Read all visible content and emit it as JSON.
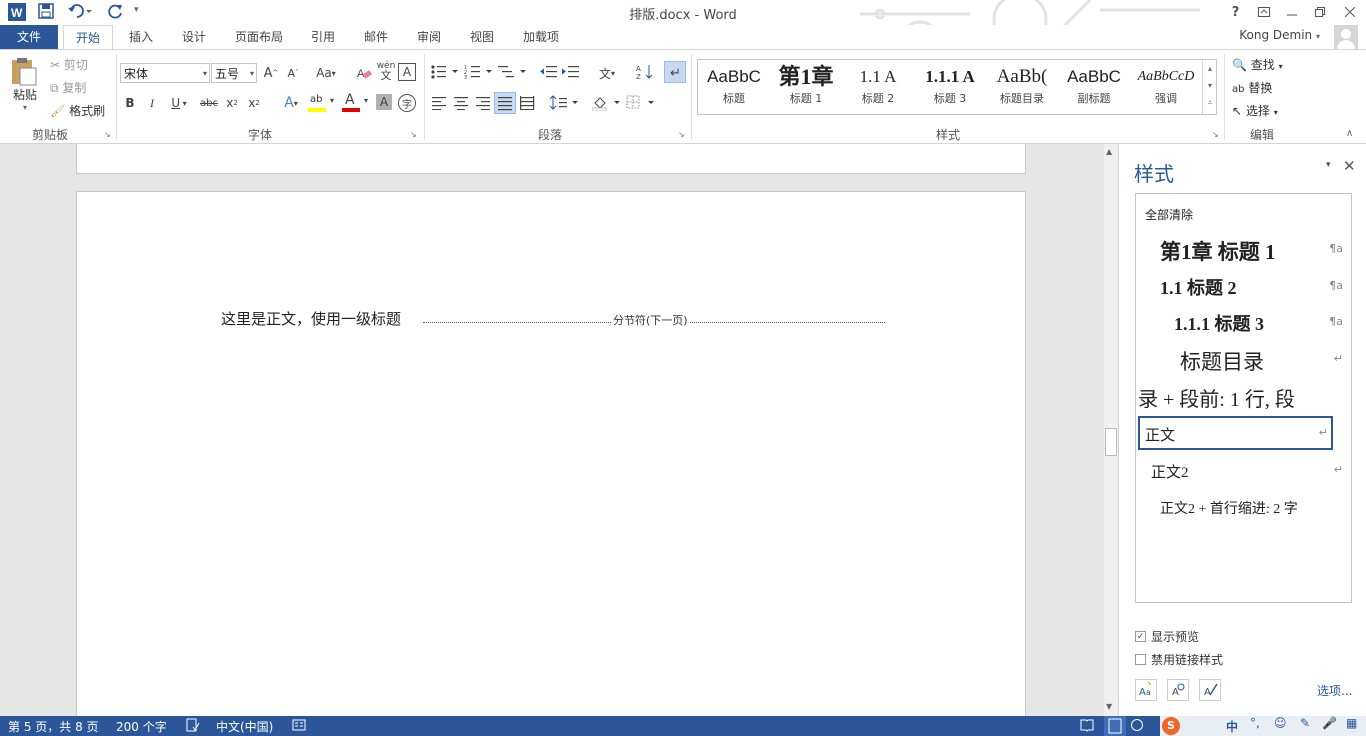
{
  "app": {
    "window_title": "排版.docx - Word",
    "help_label": "?",
    "user_name": "Kong Demin"
  },
  "tabs": [
    {
      "label": "文件"
    },
    {
      "label": "开始"
    },
    {
      "label": "插入"
    },
    {
      "label": "设计"
    },
    {
      "label": "页面布局"
    },
    {
      "label": "引用"
    },
    {
      "label": "邮件"
    },
    {
      "label": "审阅"
    },
    {
      "label": "视图"
    },
    {
      "label": "加载项"
    }
  ],
  "ribbon": {
    "clipboard": {
      "paste_label": "粘贴",
      "cut_label": "剪切",
      "copy_label": "复制",
      "format_painter_label": "格式刷",
      "group_label": "剪贴板"
    },
    "font": {
      "font_name": "宋体",
      "font_size": "五号",
      "grow_label": "A",
      "shrink_label": "A",
      "case_label": "Aa",
      "phonetic_label": "wén",
      "border_char_label": "A",
      "bold_label": "B",
      "italic_label": "I",
      "underline_label": "U",
      "strike_label": "abc",
      "subscript_label": "x",
      "superscript_label": "x",
      "effects_label": "A",
      "highlight_label": "ab",
      "color_label": "A",
      "shading_label": "A",
      "enclose_label": "字",
      "group_label": "字体"
    },
    "paragraph": {
      "group_label": "段落"
    },
    "styles": {
      "items": [
        {
          "preview": "AaBbC",
          "name": "标题"
        },
        {
          "preview": "第1章",
          "name": "标题 1"
        },
        {
          "preview": "1.1 A",
          "name": "标题 2"
        },
        {
          "preview": "1.1.1 A",
          "name": "标题 3"
        },
        {
          "preview": "AaBb(",
          "name": "标题目录"
        },
        {
          "preview": "AaBbC",
          "name": "副标题"
        },
        {
          "preview": "AaBbCcD",
          "name": "强调"
        }
      ],
      "group_label": "样式"
    },
    "editing": {
      "find_label": "查找",
      "replace_label": "替换",
      "select_label": "选择",
      "group_label": "编辑"
    }
  },
  "document": {
    "body_text": "这里是正文，使用一级标题",
    "section_break_label": "分节符(下一页)"
  },
  "styles_pane": {
    "title": "样式",
    "clear_all": "全部清除",
    "items": [
      {
        "label": "第1章  标题 1",
        "mark": "¶a"
      },
      {
        "label": "1.1  标题 2",
        "mark": "¶a"
      },
      {
        "label": "1.1.1  标题 3",
        "mark": "¶a"
      },
      {
        "label": "标题目录",
        "mark": "↵"
      },
      {
        "label": "录 + 段前: 1 行, 段",
        "mark": ""
      },
      {
        "label": "正文",
        "mark": "↵"
      },
      {
        "label": "正文2",
        "mark": "↵"
      },
      {
        "label": "正文2 + 首行缩进:  2 字",
        "mark": ""
      }
    ],
    "show_preview_label": "显示预览",
    "show_preview_checked": true,
    "disable_linked_label": "禁用链接样式",
    "disable_linked_checked": false,
    "options_link": "选项..."
  },
  "status_bar": {
    "page_info": "第 5 页，共 8 页",
    "word_count": "200 个字",
    "language": "中文(中国)",
    "ime_label": "中"
  },
  "colors": {
    "accent": "#2b579a",
    "selected_border": "#2b579a"
  }
}
